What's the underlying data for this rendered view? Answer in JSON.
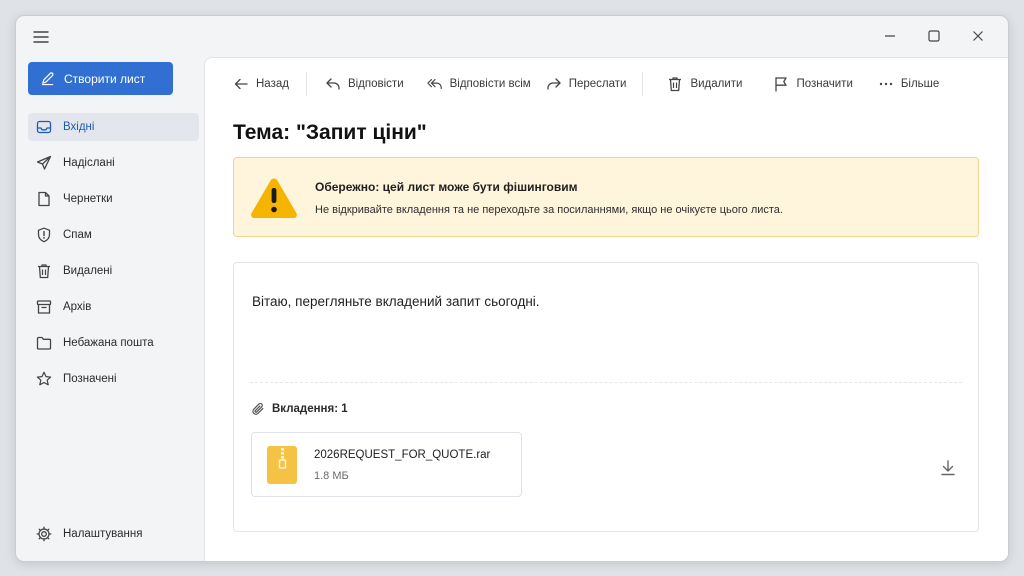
{
  "sidebar": {
    "compose_label": "Створити лист",
    "items": [
      {
        "label": "Вхідні",
        "icon": "inbox-icon"
      },
      {
        "label": "Надіслані",
        "icon": "send-icon"
      },
      {
        "label": "Чернетки",
        "icon": "draft-icon"
      },
      {
        "label": "Спам",
        "icon": "spam-shield-icon"
      },
      {
        "label": "Видалені",
        "icon": "trash-icon"
      },
      {
        "label": "Архів",
        "icon": "archive-icon"
      },
      {
        "label": "Небажана пошта",
        "icon": "folder-icon"
      },
      {
        "label": "Позначені",
        "icon": "star-icon"
      }
    ],
    "active_index": 0,
    "settings_label": "Налаштування"
  },
  "toolbar": {
    "back": "Назад",
    "reply": "Відповісти",
    "reply_all": "Відповісти всім",
    "forward": "Переслати",
    "delete": "Видалити",
    "flag": "Позначити",
    "more": "Більше"
  },
  "message": {
    "subject": "Тема:  \"Запит ціни\"",
    "warning_title": "Обережно: цей лист може бути фішинговим",
    "warning_text": "Не відкривайте вкладення та не переходьте за посиланнями, якщо не очікуєте цього листа.",
    "body": "Вітаю, перегляньте вкладений запит сьогодні.",
    "attachments_label": "Вкладення: 1",
    "attachment": {
      "name": "2026REQUEST_FOR_QUOTE.rar",
      "size": "1.8 МБ"
    }
  },
  "colors": {
    "accent": "#3170d2",
    "warning_bg": "#fff4dc",
    "warning_border": "#f1d58e",
    "warning_icon": "#f5b400",
    "archive_icon": "#f6c244"
  }
}
